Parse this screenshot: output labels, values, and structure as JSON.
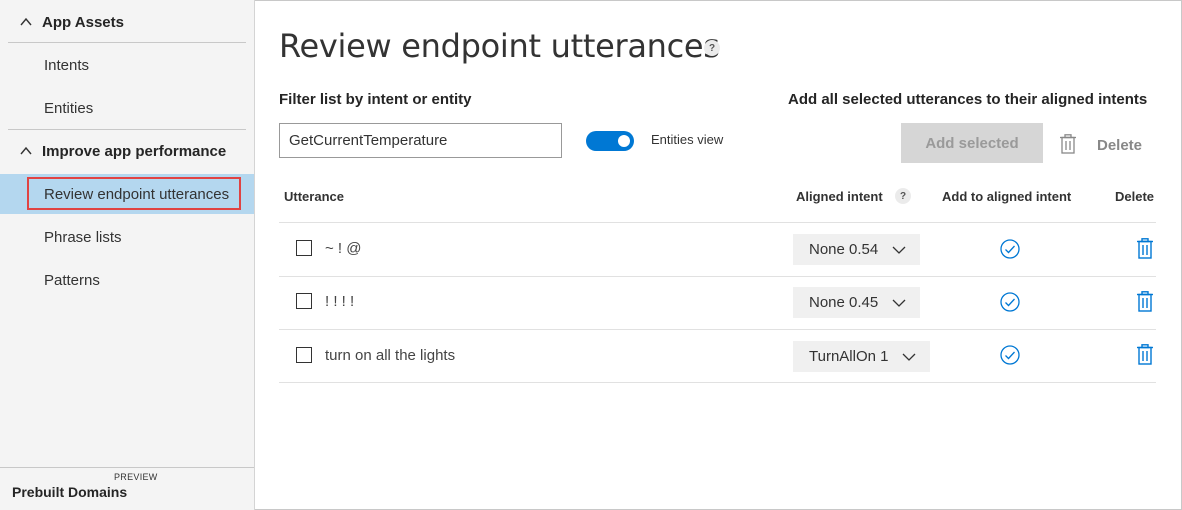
{
  "sidebar": {
    "app_assets": "App Assets",
    "intents": "Intents",
    "entities": "Entities",
    "improve": "Improve app performance",
    "review": "Review endpoint utterances",
    "phrase_lists": "Phrase lists",
    "patterns": "Patterns",
    "prebuilt": "Prebuilt Domains",
    "preview": "PREVIEW"
  },
  "main": {
    "title": "Review endpoint utterances",
    "help": "?",
    "filter_label": "Filter list by intent or entity",
    "filter_value": "GetCurrentTemperature",
    "toggle_label": "Entities view",
    "toggle_on": true,
    "add_all_label": "Add all selected utterances to their aligned intents",
    "add_selected": "Add selected",
    "delete": "Delete"
  },
  "table": {
    "headers": {
      "utterance": "Utterance",
      "aligned_intent": "Aligned intent",
      "add_to_aligned": "Add to aligned intent",
      "delete": "Delete"
    },
    "rows": [
      {
        "utterance": "~ ! @",
        "intent": "None 0.54"
      },
      {
        "utterance": "! ! ! !",
        "intent": "None 0.45"
      },
      {
        "utterance": "turn on all the lights",
        "intent": "TurnAllOn 1"
      }
    ]
  },
  "colors": {
    "accent": "#0078d4",
    "active_nav": "#b4d7ef",
    "highlight_border": "#e04343",
    "disabled_button": "#d6d6d6"
  },
  "icons": {
    "collapse": "chevron-up-icon",
    "dropdown": "chevron-down-icon",
    "add": "check-circle-icon",
    "delete": "trash-icon"
  }
}
